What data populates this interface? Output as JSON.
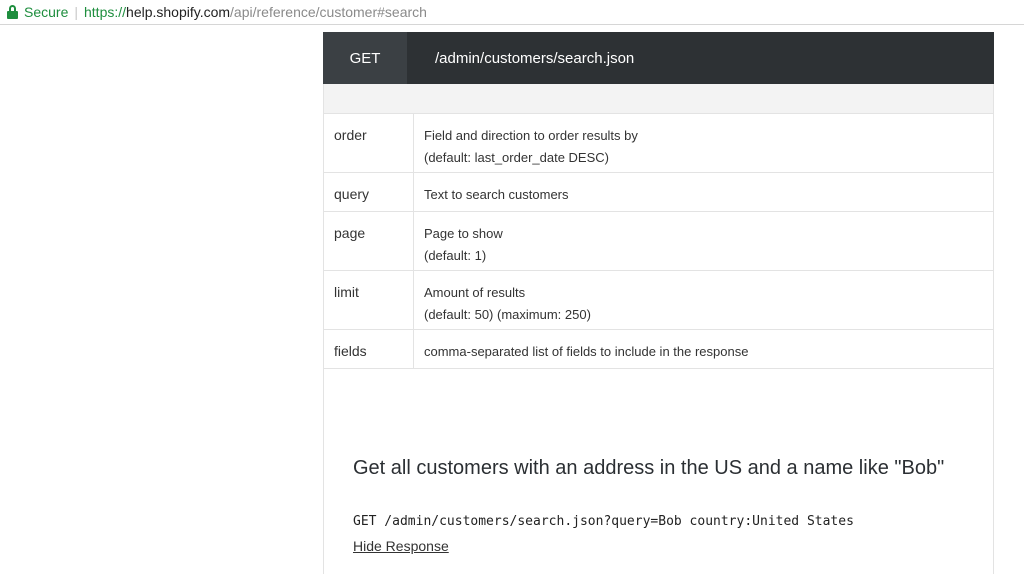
{
  "browser": {
    "secure_label": "Secure",
    "url_scheme": "https://",
    "url_host": "help.shopify.com",
    "url_path": "/api/reference/customer#search"
  },
  "endpoint": {
    "method": "GET",
    "path": "/admin/customers/search.json"
  },
  "params": [
    {
      "name": "order",
      "desc_line1": "Field and direction to order results by",
      "desc_line2": "(default: last_order_date DESC)"
    },
    {
      "name": "query",
      "desc_line1": "Text to search customers",
      "desc_line2": ""
    },
    {
      "name": "page",
      "desc_line1": "Page to show",
      "desc_line2": "(default: 1)"
    },
    {
      "name": "limit",
      "desc_line1": "Amount of results",
      "desc_line2": "(default: 50) (maximum: 250)"
    },
    {
      "name": "fields",
      "desc_line1": "comma-separated list of fields to include in the response",
      "desc_line2": ""
    }
  ],
  "example": {
    "title": "Get all customers with an address in the US and a name like \"Bob\"",
    "request": "GET /admin/customers/search.json?query=Bob country:United States",
    "toggle_label": "Hide Response"
  }
}
